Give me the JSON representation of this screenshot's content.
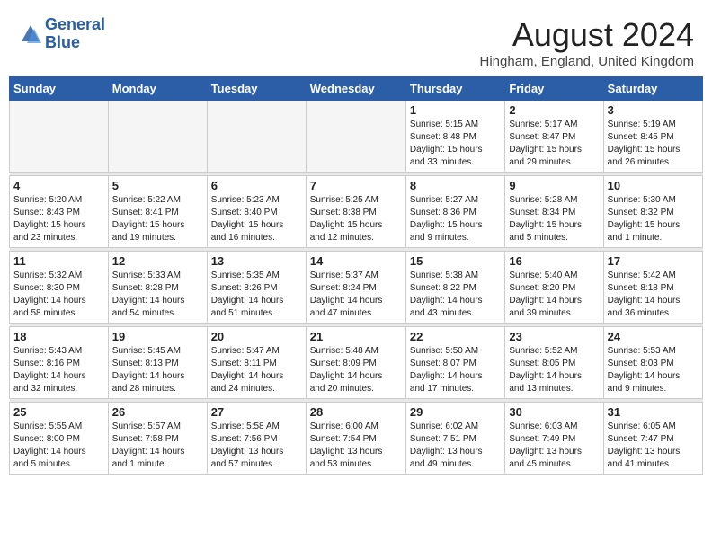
{
  "header": {
    "logo_line1": "General",
    "logo_line2": "Blue",
    "month_title": "August 2024",
    "location": "Hingham, England, United Kingdom"
  },
  "weekdays": [
    "Sunday",
    "Monday",
    "Tuesday",
    "Wednesday",
    "Thursday",
    "Friday",
    "Saturday"
  ],
  "weeks": [
    [
      {
        "day": "",
        "text": ""
      },
      {
        "day": "",
        "text": ""
      },
      {
        "day": "",
        "text": ""
      },
      {
        "day": "",
        "text": ""
      },
      {
        "day": "1",
        "text": "Sunrise: 5:15 AM\nSunset: 8:48 PM\nDaylight: 15 hours\nand 33 minutes."
      },
      {
        "day": "2",
        "text": "Sunrise: 5:17 AM\nSunset: 8:47 PM\nDaylight: 15 hours\nand 29 minutes."
      },
      {
        "day": "3",
        "text": "Sunrise: 5:19 AM\nSunset: 8:45 PM\nDaylight: 15 hours\nand 26 minutes."
      }
    ],
    [
      {
        "day": "4",
        "text": "Sunrise: 5:20 AM\nSunset: 8:43 PM\nDaylight: 15 hours\nand 23 minutes."
      },
      {
        "day": "5",
        "text": "Sunrise: 5:22 AM\nSunset: 8:41 PM\nDaylight: 15 hours\nand 19 minutes."
      },
      {
        "day": "6",
        "text": "Sunrise: 5:23 AM\nSunset: 8:40 PM\nDaylight: 15 hours\nand 16 minutes."
      },
      {
        "day": "7",
        "text": "Sunrise: 5:25 AM\nSunset: 8:38 PM\nDaylight: 15 hours\nand 12 minutes."
      },
      {
        "day": "8",
        "text": "Sunrise: 5:27 AM\nSunset: 8:36 PM\nDaylight: 15 hours\nand 9 minutes."
      },
      {
        "day": "9",
        "text": "Sunrise: 5:28 AM\nSunset: 8:34 PM\nDaylight: 15 hours\nand 5 minutes."
      },
      {
        "day": "10",
        "text": "Sunrise: 5:30 AM\nSunset: 8:32 PM\nDaylight: 15 hours\nand 1 minute."
      }
    ],
    [
      {
        "day": "11",
        "text": "Sunrise: 5:32 AM\nSunset: 8:30 PM\nDaylight: 14 hours\nand 58 minutes."
      },
      {
        "day": "12",
        "text": "Sunrise: 5:33 AM\nSunset: 8:28 PM\nDaylight: 14 hours\nand 54 minutes."
      },
      {
        "day": "13",
        "text": "Sunrise: 5:35 AM\nSunset: 8:26 PM\nDaylight: 14 hours\nand 51 minutes."
      },
      {
        "day": "14",
        "text": "Sunrise: 5:37 AM\nSunset: 8:24 PM\nDaylight: 14 hours\nand 47 minutes."
      },
      {
        "day": "15",
        "text": "Sunrise: 5:38 AM\nSunset: 8:22 PM\nDaylight: 14 hours\nand 43 minutes."
      },
      {
        "day": "16",
        "text": "Sunrise: 5:40 AM\nSunset: 8:20 PM\nDaylight: 14 hours\nand 39 minutes."
      },
      {
        "day": "17",
        "text": "Sunrise: 5:42 AM\nSunset: 8:18 PM\nDaylight: 14 hours\nand 36 minutes."
      }
    ],
    [
      {
        "day": "18",
        "text": "Sunrise: 5:43 AM\nSunset: 8:16 PM\nDaylight: 14 hours\nand 32 minutes."
      },
      {
        "day": "19",
        "text": "Sunrise: 5:45 AM\nSunset: 8:13 PM\nDaylight: 14 hours\nand 28 minutes."
      },
      {
        "day": "20",
        "text": "Sunrise: 5:47 AM\nSunset: 8:11 PM\nDaylight: 14 hours\nand 24 minutes."
      },
      {
        "day": "21",
        "text": "Sunrise: 5:48 AM\nSunset: 8:09 PM\nDaylight: 14 hours\nand 20 minutes."
      },
      {
        "day": "22",
        "text": "Sunrise: 5:50 AM\nSunset: 8:07 PM\nDaylight: 14 hours\nand 17 minutes."
      },
      {
        "day": "23",
        "text": "Sunrise: 5:52 AM\nSunset: 8:05 PM\nDaylight: 14 hours\nand 13 minutes."
      },
      {
        "day": "24",
        "text": "Sunrise: 5:53 AM\nSunset: 8:03 PM\nDaylight: 14 hours\nand 9 minutes."
      }
    ],
    [
      {
        "day": "25",
        "text": "Sunrise: 5:55 AM\nSunset: 8:00 PM\nDaylight: 14 hours\nand 5 minutes."
      },
      {
        "day": "26",
        "text": "Sunrise: 5:57 AM\nSunset: 7:58 PM\nDaylight: 14 hours\nand 1 minute."
      },
      {
        "day": "27",
        "text": "Sunrise: 5:58 AM\nSunset: 7:56 PM\nDaylight: 13 hours\nand 57 minutes."
      },
      {
        "day": "28",
        "text": "Sunrise: 6:00 AM\nSunset: 7:54 PM\nDaylight: 13 hours\nand 53 minutes."
      },
      {
        "day": "29",
        "text": "Sunrise: 6:02 AM\nSunset: 7:51 PM\nDaylight: 13 hours\nand 49 minutes."
      },
      {
        "day": "30",
        "text": "Sunrise: 6:03 AM\nSunset: 7:49 PM\nDaylight: 13 hours\nand 45 minutes."
      },
      {
        "day": "31",
        "text": "Sunrise: 6:05 AM\nSunset: 7:47 PM\nDaylight: 13 hours\nand 41 minutes."
      }
    ]
  ]
}
